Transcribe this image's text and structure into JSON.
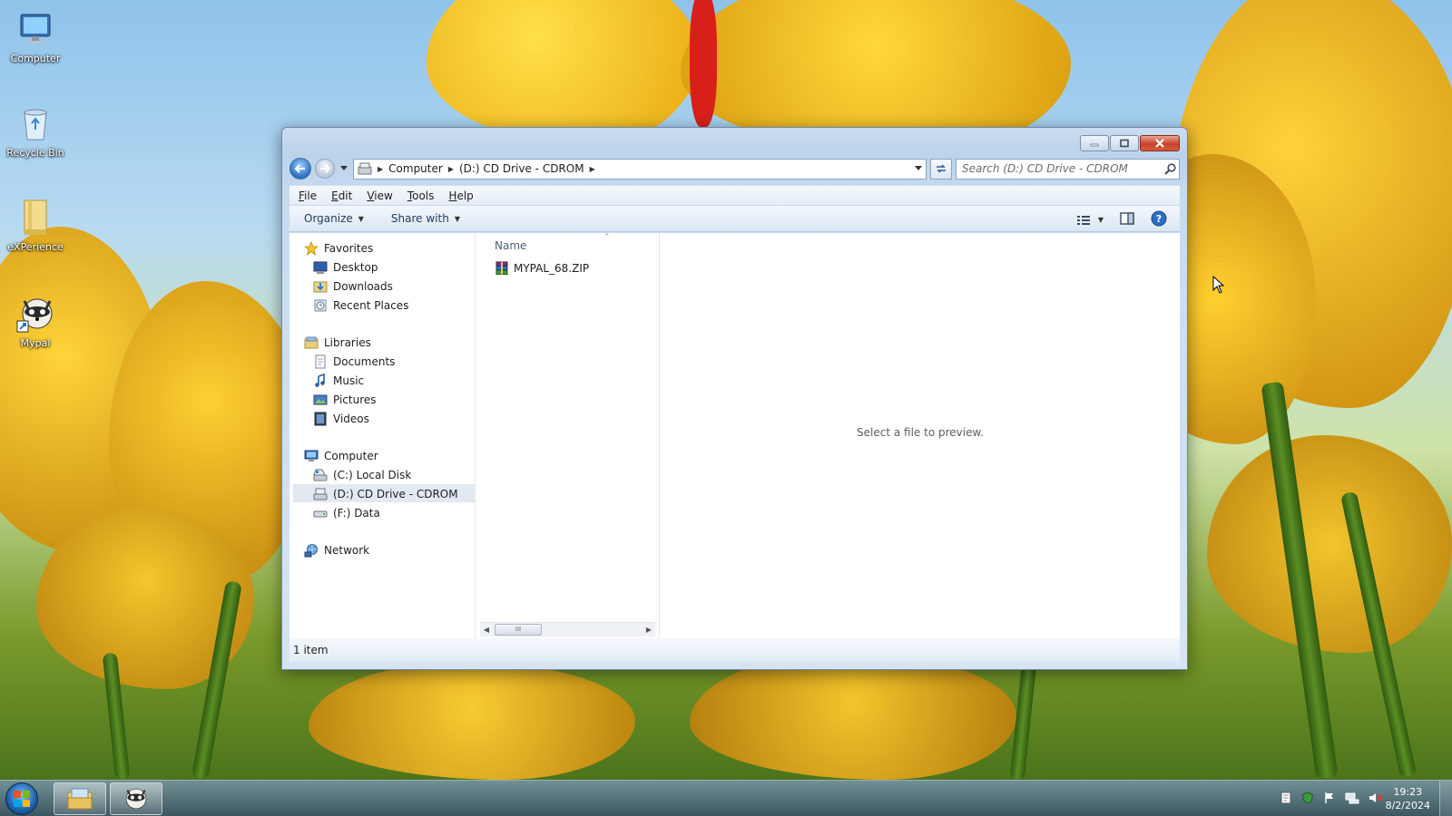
{
  "desktop": {
    "icons": [
      {
        "label": "Computer",
        "icon": "computer-icon"
      },
      {
        "label": "Recycle Bin",
        "icon": "recycle-bin-icon"
      },
      {
        "label": "eXPerience",
        "icon": "folder-icon"
      },
      {
        "label": "Mypal",
        "icon": "mypal-icon"
      }
    ]
  },
  "window": {
    "address": {
      "crumbs": [
        "Computer",
        "(D:) CD Drive - CDROM"
      ]
    },
    "search": {
      "placeholder": "Search (D:) CD Drive - CDROM"
    },
    "menu": [
      "File",
      "Edit",
      "View",
      "Tools",
      "Help"
    ],
    "commands": {
      "organize": "Organize",
      "share_with": "Share with"
    },
    "nav": {
      "favorites": {
        "label": "Favorites",
        "items": [
          "Desktop",
          "Downloads",
          "Recent Places"
        ]
      },
      "libraries": {
        "label": "Libraries",
        "items": [
          "Documents",
          "Music",
          "Pictures",
          "Videos"
        ]
      },
      "computer": {
        "label": "Computer",
        "items": [
          "(C:) Local Disk",
          "(D:) CD Drive - CDROM",
          "(F:) Data"
        ],
        "selected": "(D:) CD Drive - CDROM"
      },
      "network": {
        "label": "Network"
      }
    },
    "files": {
      "column_name": "Name",
      "items": [
        {
          "name": "MYPAL_68.ZIP",
          "icon": "winrar-archive-icon"
        }
      ],
      "scrollbar_thumb": "III"
    },
    "preview": {
      "message": "Select a file to preview."
    },
    "status": {
      "item_count": "1 item"
    }
  },
  "taskbar": {
    "clock": {
      "time": "19:23",
      "date": "8/2/2024"
    }
  },
  "colors": {
    "selection": "#e2e9f1",
    "close_button": "#c7442b",
    "window_frame": "#c9dcf0"
  }
}
